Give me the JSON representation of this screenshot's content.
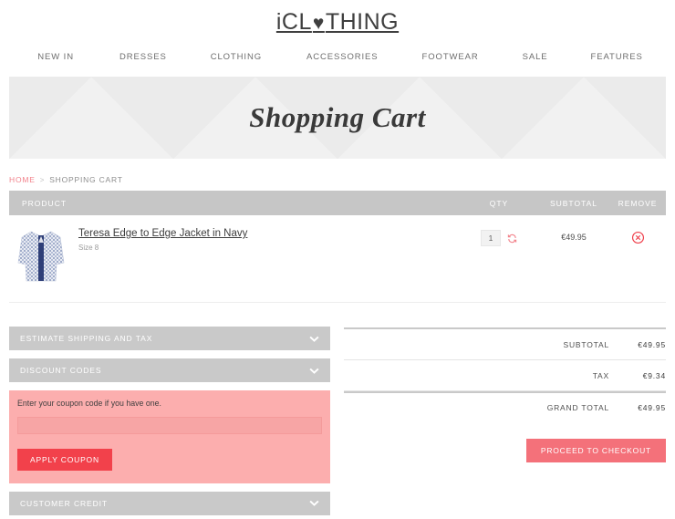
{
  "site": {
    "logo_prefix": "iCL",
    "logo_heart": "♥",
    "logo_suffix": "THING"
  },
  "nav": {
    "items": [
      {
        "label": "NEW IN"
      },
      {
        "label": "DRESSES"
      },
      {
        "label": "CLOTHING"
      },
      {
        "label": "ACCESSORIES"
      },
      {
        "label": "FOOTWEAR"
      },
      {
        "label": "SALE"
      },
      {
        "label": "FEATURES"
      }
    ]
  },
  "hero": {
    "title": "Shopping Cart"
  },
  "breadcrumb": {
    "home": "HOME",
    "separator": ">",
    "current": "SHOPPING CART"
  },
  "cart": {
    "headers": {
      "product": "PRODUCT",
      "qty": "QTY",
      "subtotal": "SUBTOTAL",
      "remove": "REMOVE"
    },
    "items": [
      {
        "name": "Teresa Edge to Edge Jacket in Navy",
        "size": "Size 8",
        "qty": "1",
        "subtotal": "€49.95",
        "update_icon": "refresh-icon",
        "remove_icon": "circle-x-icon"
      }
    ]
  },
  "panels": {
    "shipping": {
      "label": "ESTIMATE SHIPPING AND TAX",
      "icon": "chevron-down-icon"
    },
    "discount": {
      "label": "DISCOUNT CODES",
      "icon": "chevron-down-icon"
    },
    "credit": {
      "label": "CUSTOMER CREDIT",
      "icon": "chevron-down-icon"
    }
  },
  "coupon": {
    "label": "Enter your coupon code if you have one.",
    "value": "",
    "placeholder": "",
    "apply_label": "APPLY COUPON"
  },
  "totals": {
    "rows": [
      {
        "label": "SUBTOTAL",
        "value": "€49.95"
      },
      {
        "label": "TAX",
        "value": "€9.34"
      },
      {
        "label": "GRAND TOTAL",
        "value": "€49.95"
      }
    ],
    "checkout_label": "PROCEED TO CHECKOUT"
  },
  "colors": {
    "accent_pink": "#f2828b",
    "button_red": "#f2414b",
    "checkout_coral": "#f4717a",
    "panel_gray": "#c9c9c9",
    "coupon_pink": "#fcaeae"
  }
}
